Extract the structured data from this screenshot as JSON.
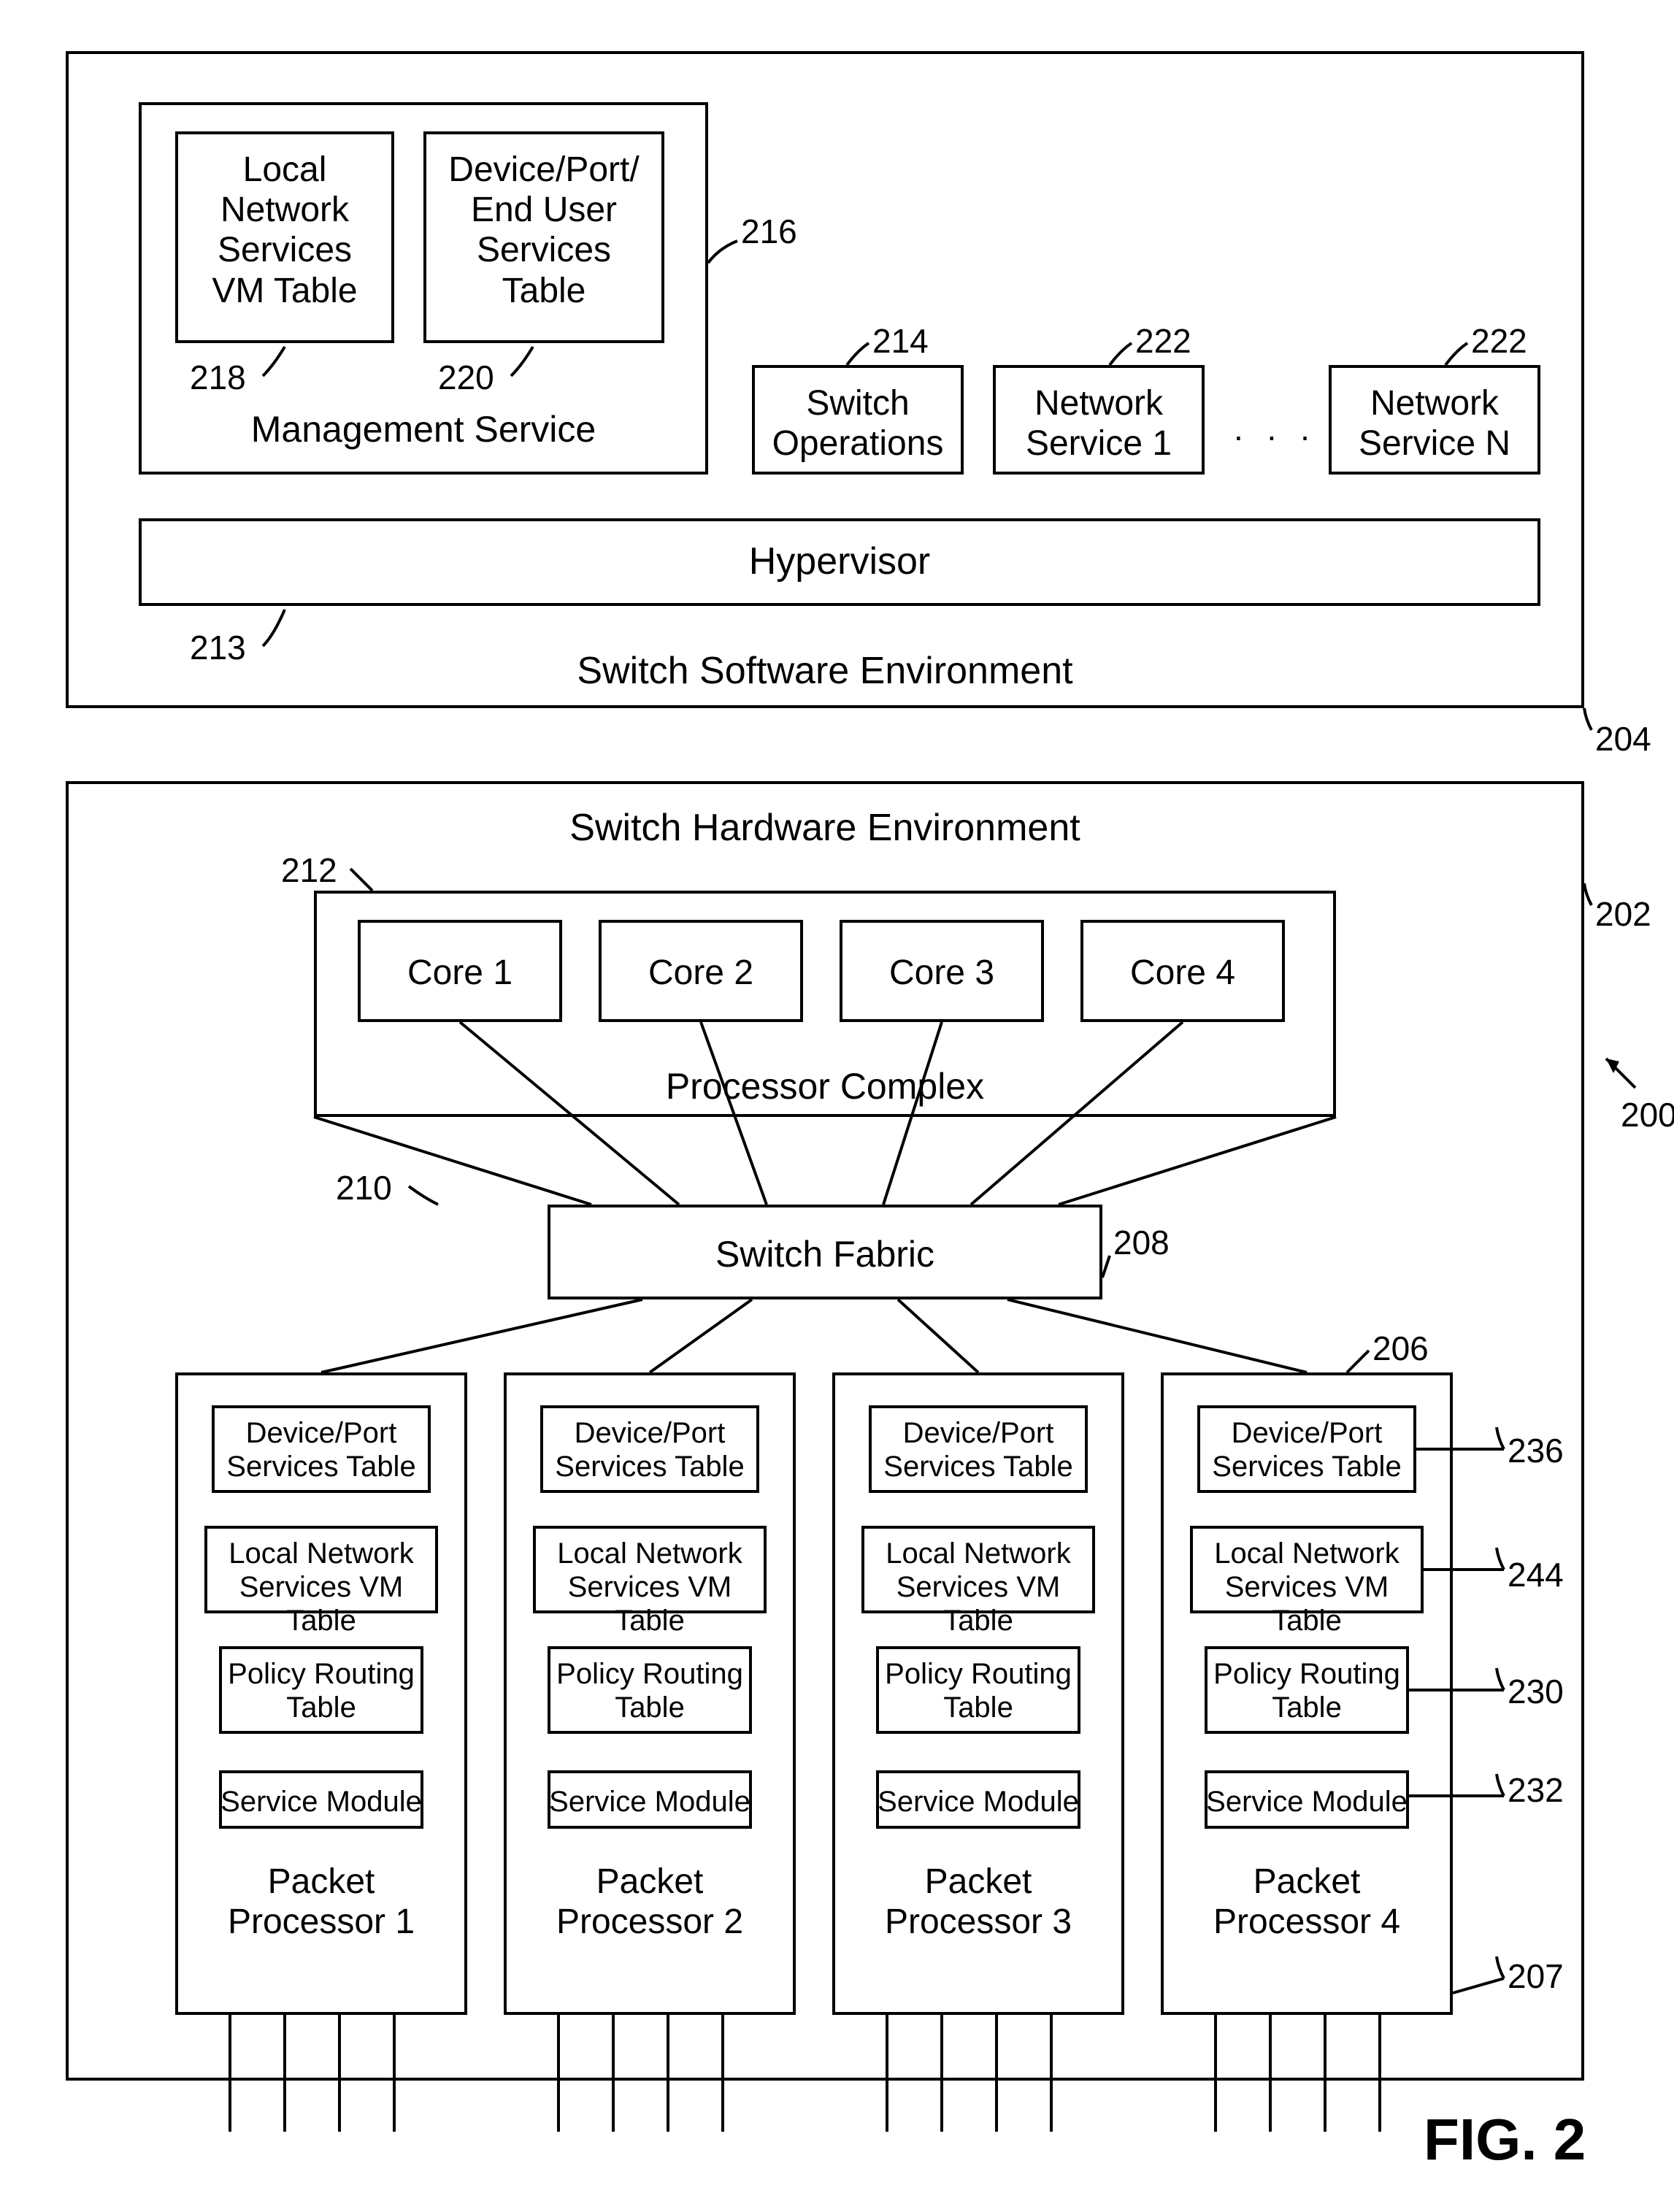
{
  "figure_label": "FIG. 2",
  "refs": {
    "r200": "200",
    "r202": "202",
    "r204": "204",
    "r206": "206",
    "r207": "207",
    "r208": "208",
    "r210": "210",
    "r212": "212",
    "r213": "213",
    "r214": "214",
    "r216": "216",
    "r218": "218",
    "r220": "220",
    "r222a": "222",
    "r222b": "222",
    "r230": "230",
    "r232": "232",
    "r236": "236",
    "r244": "244"
  },
  "sw_env": {
    "title": "Switch Software Environment",
    "hypervisor": "Hypervisor",
    "mgmt": {
      "title": "Management Service",
      "vm_table": "Local\nNetwork\nServices\nVM Table",
      "dev_table": "Device/Port/\nEnd User\nServices\nTable"
    },
    "switch_ops": "Switch\nOperations",
    "net_svc_1": "Network\nService 1",
    "net_svc_n": "Network\nService N",
    "ellipsis": ". . ."
  },
  "hw_env": {
    "title": "Switch Hardware Environment",
    "proc_complex": "Processor Complex",
    "cores": [
      "Core 1",
      "Core 2",
      "Core 3",
      "Core 4"
    ],
    "switch_fabric": "Switch Fabric",
    "pp_labels": [
      "Packet\nProcessor 1",
      "Packet\nProcessor 2",
      "Packet\nProcessor 3",
      "Packet\nProcessor 4"
    ],
    "tables": {
      "dev": "Device/Port\nServices Table",
      "vm": "Local Network\nServices VM Table",
      "policy": "Policy Routing\nTable",
      "svc": "Service Module"
    }
  }
}
